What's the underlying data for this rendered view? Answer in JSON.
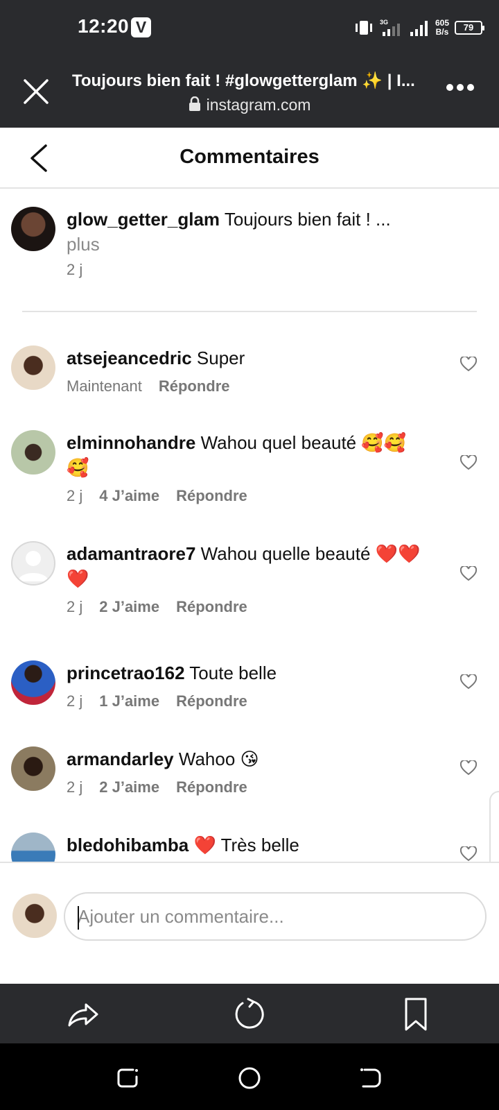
{
  "status_bar": {
    "time": "12:20",
    "app_badge": "V",
    "network": "3G",
    "speed_value": "605",
    "speed_unit": "B/s",
    "battery": "79"
  },
  "browser": {
    "title": "Toujours bien fait ! #glowgetterglam ✨ | I...",
    "url": "instagram.com"
  },
  "header": {
    "title": "Commentaires"
  },
  "caption": {
    "username": "glow_getter_glam",
    "text": "Toujours bien fait ! ...",
    "more_label": "plus",
    "time": "2 j"
  },
  "comments": [
    {
      "username": "atsejeancedric",
      "text": "Super",
      "time": "Maintenant",
      "likes": "",
      "reply": "Répondre"
    },
    {
      "username": "elminnohandre",
      "text": "Wahou quel beauté 🥰🥰🥰",
      "time": "2 j",
      "likes": "4 J’aime",
      "reply": "Répondre"
    },
    {
      "username": "adamantraore7",
      "text": "Wahou quelle beauté ❤️❤️❤️",
      "time": "2 j",
      "likes": "2 J’aime",
      "reply": "Répondre"
    },
    {
      "username": "princetrao162",
      "text": "Toute belle",
      "time": "2 j",
      "likes": "1 J’aime",
      "reply": "Répondre"
    },
    {
      "username": "armandarley",
      "text": "Wahoo 😘",
      "time": "2 j",
      "likes": "2 J’aime",
      "reply": "Répondre"
    },
    {
      "username": "bledohibamba",
      "text": "❤️ Très belle",
      "time": "",
      "likes": "",
      "reply": ""
    }
  ],
  "composer": {
    "placeholder": "Ajouter un commentaire..."
  },
  "icons": {
    "close": "close-icon",
    "lock": "lock-icon",
    "more": "more-icon",
    "back": "back-arrow-icon",
    "heart": "heart-icon",
    "share": "share-icon",
    "reload": "reload-icon",
    "bookmark": "bookmark-icon",
    "recents": "recents-icon",
    "home": "home-icon",
    "nav_back": "nav-back-icon"
  },
  "colors": {
    "bar": "#2a2b2e",
    "text": "#111111",
    "muted": "#777777",
    "divider": "#e3e3e3"
  }
}
